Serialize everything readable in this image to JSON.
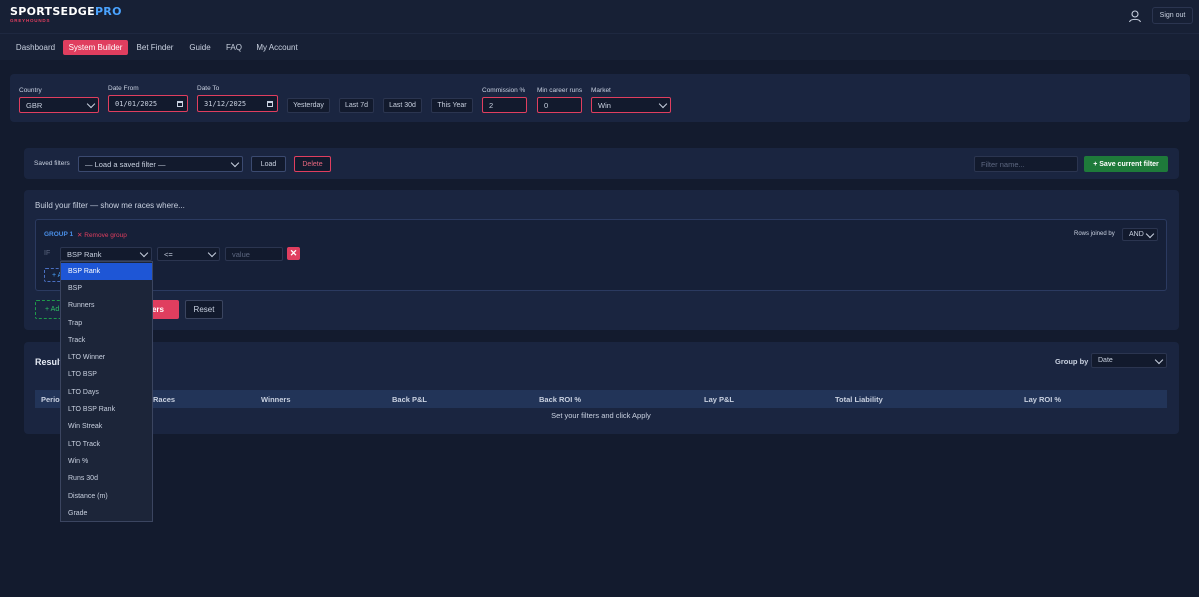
{
  "brand": {
    "name_a": "SPORTSEDGE",
    "name_b": "PRO",
    "subtitle": "GREYHOUNDS"
  },
  "header": {
    "signout_label": "Sign out"
  },
  "nav": {
    "items": [
      {
        "label": "Dashboard"
      },
      {
        "label": "System Builder"
      },
      {
        "label": "Bet Finder"
      },
      {
        "label": "Guide"
      },
      {
        "label": "FAQ"
      },
      {
        "label": "My Account"
      }
    ]
  },
  "filters": {
    "country_label": "Country",
    "country_value": "GBR",
    "date_from_label": "Date From",
    "date_from_value": "01/01/2025",
    "date_to_label": "Date To",
    "date_to_value": "31/12/2025",
    "quick": [
      "Yesterday",
      "Last 7d",
      "Last 30d",
      "This Year"
    ],
    "commission_label": "Commission %",
    "commission_value": "2",
    "min_runs_label": "Min career runs",
    "min_runs_value": "0",
    "market_label": "Market",
    "market_value": "Win"
  },
  "saved": {
    "label": "Saved filters",
    "select_value": "— Load a saved filter —",
    "load_label": "Load",
    "delete_label": "Delete",
    "name_placeholder": "Filter name...",
    "save_label": "+ Save current filter"
  },
  "builder": {
    "heading": "Build your filter — show me races where...",
    "group_label": "GROUP 1",
    "remove_group": "✕ Remove group",
    "rows_joined_label": "Rows joined by",
    "rows_joined_value": "AND",
    "if_label": "IF",
    "field_value": "BSP Rank",
    "operator_value": "<=",
    "value_placeholder": "value",
    "add_row_label": "+ A",
    "add_group_label": "+ Ad",
    "apply_label": "ers",
    "reset_label": "Reset"
  },
  "dropdown_options": [
    "BSP Rank",
    "BSP",
    "Runners",
    "Trap",
    "Track",
    "LTO Winner",
    "LTO BSP",
    "LTO Days",
    "LTO BSP Rank",
    "Win Streak",
    "LTO Track",
    "Win %",
    "Runs 30d",
    "Distance (m)",
    "Grade"
  ],
  "results": {
    "title": "Result",
    "group_by_label": "Group by",
    "group_by_value": "Date",
    "columns": [
      "Period",
      "Races",
      "Winners",
      "Back P&L",
      "Back ROI %",
      "Lay P&L",
      "Total Liability",
      "Lay ROI %"
    ],
    "empty_message": "Set your filters and click Apply"
  },
  "colors": {
    "accent": "#e03e5f",
    "brand_blue": "#4aa3ff",
    "save_green": "#1e7a3a",
    "selected": "#1e56d6"
  }
}
